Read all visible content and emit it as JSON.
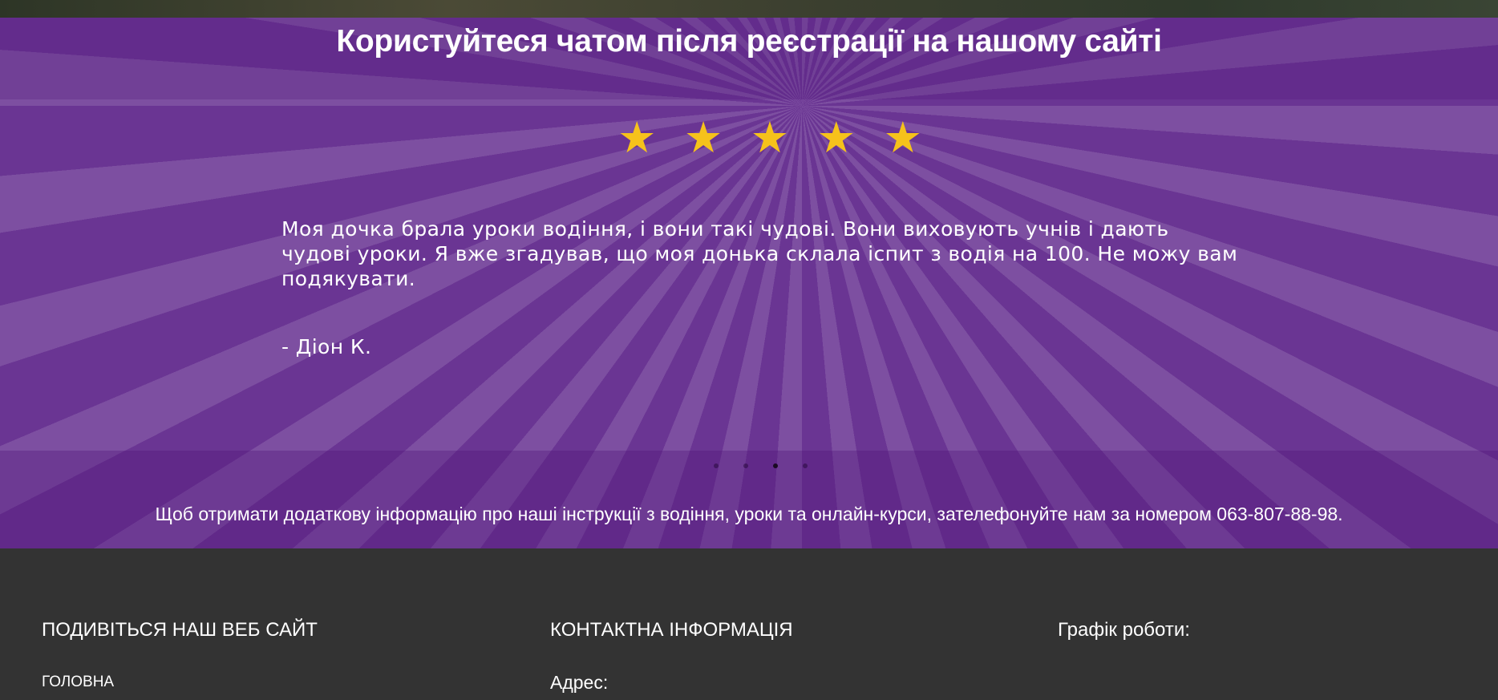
{
  "banner": {
    "title": "Користуйтеся чатом після реєстрації на нашому сайті"
  },
  "testimonial": {
    "rating": 5,
    "rating_max": 5,
    "star_color": "#f6c21b",
    "quote": "Моя дочка брала уроки водіння, і вони такі чудові. Вони виховують учнів і дають чудові уроки. Я вже згадував, що моя донька склала іспит з водія на 100. Не можу вам подякувати.",
    "author": "- Діон К."
  },
  "carousel": {
    "slide_count": 4,
    "active_index": 2
  },
  "info": {
    "text": "Щоб отримати додаткову інформацію про наші інструкції з водіння, уроки та онлайн-курси, зателефонуйте нам за номером 063-807-88-98."
  },
  "footer": {
    "sitemap": {
      "heading": "ПОДИВІТЬСЯ НАШ ВЕБ САЙТ",
      "links": [
        "ГОЛОВНА"
      ]
    },
    "contact": {
      "heading": "КОНТАКТНА ІНФОРМАЦІЯ",
      "address_label": "Адрес:"
    },
    "hours": {
      "heading": "Графік роботи:"
    }
  },
  "colors": {
    "purple": "#6a3593",
    "footer_bg": "#333333",
    "text": "#ffffff"
  }
}
